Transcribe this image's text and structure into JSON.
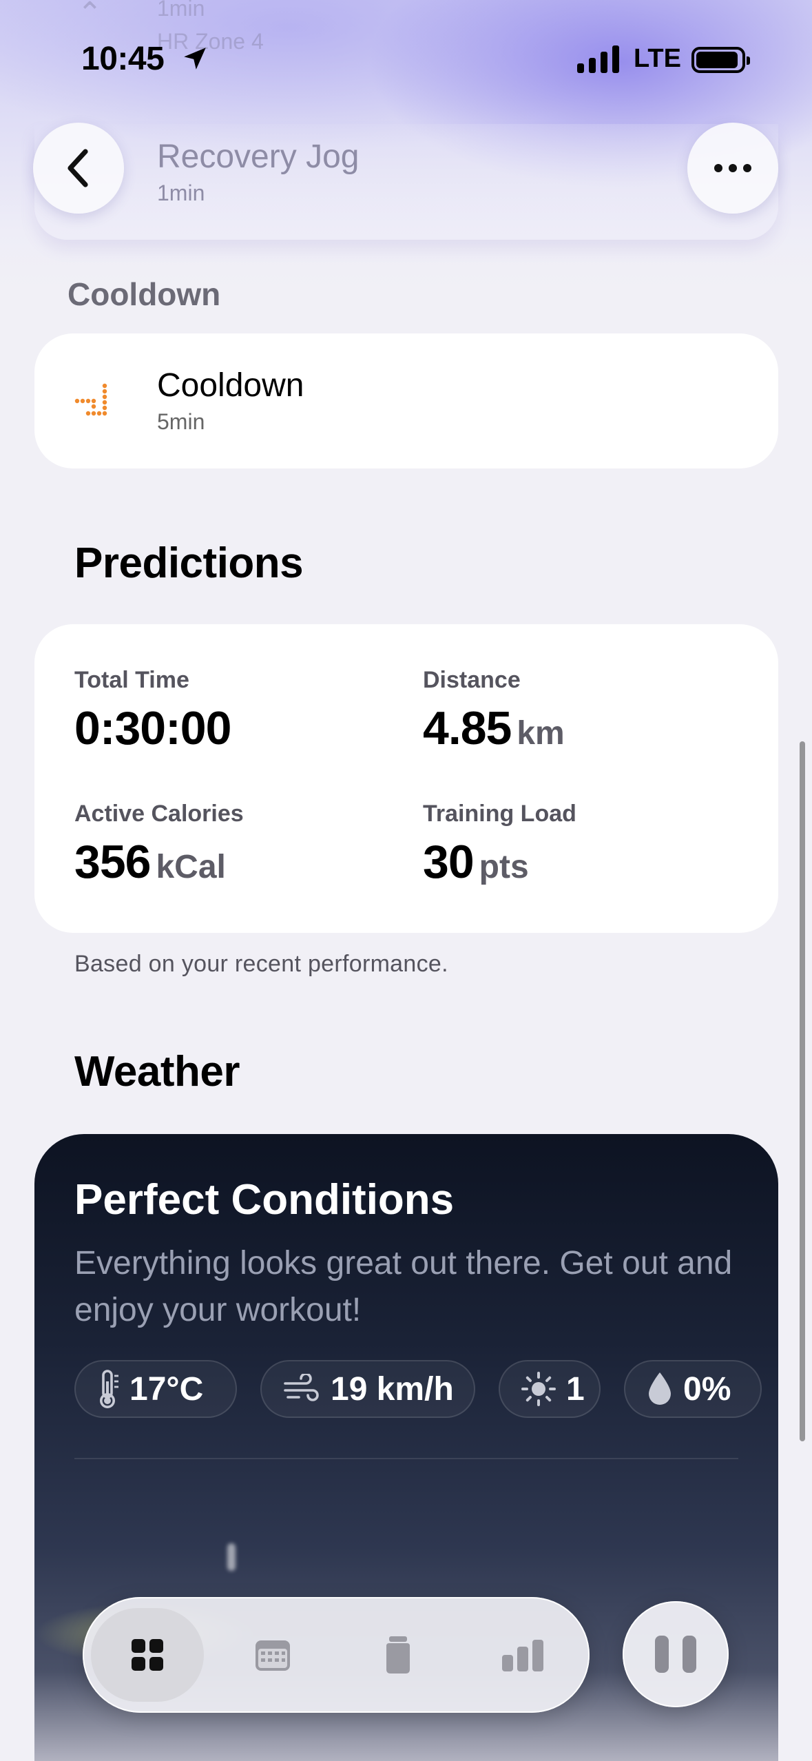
{
  "status_bar": {
    "time": "10:45",
    "network": "LTE"
  },
  "ghost": {
    "duration": "1min",
    "zone": "HR Zone 4"
  },
  "header": {
    "title": "Recovery Jog",
    "subtitle": "1min"
  },
  "cooldown": {
    "section_label": "Cooldown",
    "item_title": "Cooldown",
    "item_duration": "5min",
    "icon": "cooldown-steps-icon",
    "icon_color": "#f08a2c"
  },
  "predictions": {
    "title": "Predictions",
    "total_time": {
      "label": "Total Time",
      "value": "0:30:00"
    },
    "distance": {
      "label": "Distance",
      "value": "4.85",
      "unit": "km"
    },
    "active_calories": {
      "label": "Active Calories",
      "value": "356",
      "unit": "kCal"
    },
    "training_load": {
      "label": "Training Load",
      "value": "30",
      "unit": "pts"
    },
    "note": "Based on your recent performance."
  },
  "weather": {
    "title": "Weather",
    "headline": "Perfect Conditions",
    "description": "Everything looks great out there. Get out and enjoy your workout!",
    "chips": [
      {
        "icon": "thermometer-icon",
        "value": "17°C"
      },
      {
        "icon": "wind-icon",
        "value": "19 km/h"
      },
      {
        "icon": "sun-icon",
        "value": "1"
      },
      {
        "icon": "raindrop-icon",
        "value": "0%"
      }
    ]
  },
  "tabbar": {
    "tabs": [
      {
        "icon": "grid-icon",
        "active": true
      },
      {
        "icon": "calendar-icon",
        "active": false
      },
      {
        "icon": "jar-icon",
        "active": false
      },
      {
        "icon": "bar-chart-icon",
        "active": false
      }
    ],
    "pause_icon": "pause-icon"
  },
  "colors": {
    "accent_glow": "#8c82eb",
    "weather_card_top": "#0d1322",
    "background": "#f1f0f6"
  }
}
